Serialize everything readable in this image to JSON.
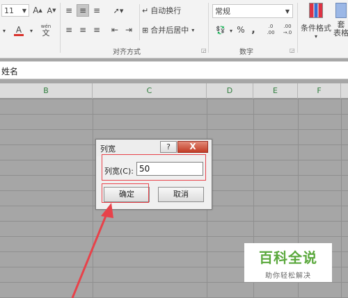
{
  "ribbon": {
    "font_size": "11",
    "grow_font_glyph": "A",
    "shrink_font_glyph": "A",
    "wen_label": "wén",
    "wen_char": "文",
    "wrap_text_label": "自动换行",
    "merge_center_label": "合并后居中",
    "alignment_group_label": "对齐方式",
    "number_format_value": "常规",
    "percent_label": "%",
    "comma_label": ",",
    "dec_increase_top": ".0",
    "dec_increase_bottom": ".00",
    "dec_decrease_top": ".00",
    "dec_decrease_bottom": "→.0",
    "number_group_label": "数字",
    "conditional_format_label": "条件格式",
    "table_format_label": "套用\n表格",
    "table_format_label_top": "套",
    "table_format_label_bottom": "表格"
  },
  "name_box": {
    "text": "姓名"
  },
  "columns": [
    "B",
    "C",
    "D",
    "E",
    "F"
  ],
  "dialog": {
    "title": "列宽",
    "help_label": "?",
    "close_label": "X",
    "field_label": "列宽(C):",
    "field_value": "50",
    "ok_label": "确定",
    "cancel_label": "取消"
  },
  "watermark": {
    "title": "百科全说",
    "subtitle": "助你轻松解决"
  },
  "colors": {
    "annotation_red": "#e8424a",
    "watermark_green": "#5aa83c",
    "font_color_red": "#d9312b"
  }
}
